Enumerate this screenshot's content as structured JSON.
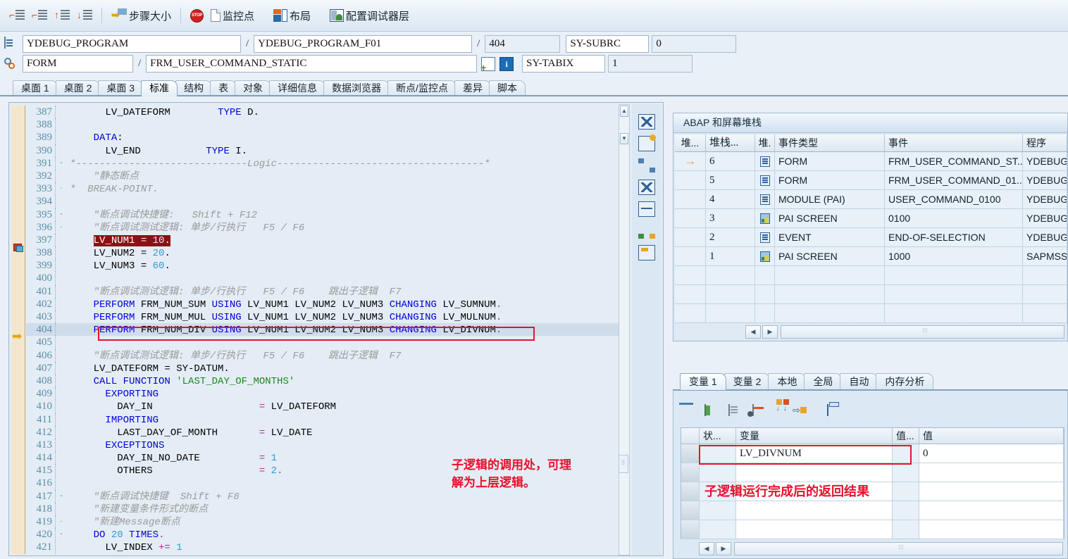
{
  "toolbar": {
    "step_icons": [
      "step-into-icon",
      "step-over-icon",
      "step-return-icon",
      "run-to-cursor-icon"
    ],
    "step_size_label": "步骤大小",
    "stop_label": "STOP",
    "watchpoint_label": "监控点",
    "layout_label": "布局",
    "config_layer_label": "配置调试器层"
  },
  "fields": {
    "program_main": "YDEBUG_PROGRAM",
    "program_include": "YDEBUG_PROGRAM_F01",
    "line_number": "404",
    "sy_subrc_label": "SY-SUBRC",
    "sy_subrc_value": "0",
    "event_type": "FORM",
    "event_name": "FRM_USER_COMMAND_STATIC",
    "sy_tabix_label": "SY-TABIX",
    "sy_tabix_value": "1",
    "separator": "/"
  },
  "tabs": [
    {
      "label": "桌面 1",
      "active": false
    },
    {
      "label": "桌面 2",
      "active": false
    },
    {
      "label": "桌面 3",
      "active": false
    },
    {
      "label": "标准",
      "active": true
    },
    {
      "label": "结构",
      "active": false
    },
    {
      "label": "表",
      "active": false
    },
    {
      "label": "对象",
      "active": false
    },
    {
      "label": "详细信息",
      "active": false
    },
    {
      "label": "数据浏览器",
      "active": false
    },
    {
      "label": "断点/监控点",
      "active": false
    },
    {
      "label": "差异",
      "active": false
    },
    {
      "label": "脚本",
      "active": false
    }
  ],
  "code": {
    "lines": [
      {
        "n": "387",
        "fold": "",
        "mark": "",
        "html": "      <span class=\"k\">LV_DATEFORM</span>        <span class=\"kw\">TYPE</span> D."
      },
      {
        "n": "388",
        "fold": "",
        "mark": "",
        "html": ""
      },
      {
        "n": "389",
        "fold": "",
        "mark": "",
        "html": "    <span class=\"kw\">DATA</span>:"
      },
      {
        "n": "390",
        "fold": "",
        "mark": "",
        "html": "      LV_END           <span class=\"kw\">TYPE</span> I."
      },
      {
        "n": "391",
        "fold": "-",
        "mark": "",
        "html": "<span class=\"cm\">*-----------------------------Logic-----------------------------------*</span>"
      },
      {
        "n": "392",
        "fold": "",
        "mark": "",
        "html": "    <span class=\"cm\">\"静态断点</span>"
      },
      {
        "n": "393",
        "fold": "·",
        "mark": "",
        "html": "<span class=\"cm\">*  BREAK-POINT.</span>"
      },
      {
        "n": "394",
        "fold": "",
        "mark": "",
        "html": ""
      },
      {
        "n": "395",
        "fold": "-",
        "mark": "",
        "html": "    <span class=\"cm\">\"断点调试快捷键:   Shift + F12</span>"
      },
      {
        "n": "396",
        "fold": "·",
        "mark": "",
        "html": "    <span class=\"cm\">\"断点调试测试逻辑: 单步/行执行   F5 / F6</span>"
      },
      {
        "n": "397",
        "fold": "",
        "mark": "bp",
        "html": "HILITE"
      },
      {
        "n": "398",
        "fold": "",
        "mark": "",
        "html": "    LV_NUM2 = <span class=\"num\">20</span>."
      },
      {
        "n": "399",
        "fold": "",
        "mark": "",
        "html": "    LV_NUM3 = <span class=\"num\">60</span>."
      },
      {
        "n": "400",
        "fold": "",
        "mark": "",
        "html": ""
      },
      {
        "n": "401",
        "fold": "",
        "mark": "",
        "html": "    <span class=\"cm\">\"断点调试测试逻辑: 单步/行执行   F5 / F6    跳出子逻辑  F7</span>"
      },
      {
        "n": "402",
        "fold": "",
        "mark": "",
        "html": "    <span class=\"kw\">PERFORM</span> FRM_NUM_SUM <span class=\"kw\">USING</span> LV_NUM1 LV_NUM2 LV_NUM3 <span class=\"kw\">CHANGING</span> LV_SUMNUM<span class=\"op\">.</span>"
      },
      {
        "n": "403",
        "fold": "",
        "mark": "",
        "html": "    <span class=\"kw\">PERFORM</span> FRM_NUM_MUL <span class=\"kw\">USING</span> LV_NUM1 LV_NUM2 LV_NUM3 <span class=\"kw\">CHANGING</span> LV_MULNUM<span class=\"op\">.</span>"
      },
      {
        "n": "404",
        "fold": "",
        "mark": "cur",
        "html": "    <span class=\"kw\">PERFORM</span> FRM_NUM_DIV <span class=\"kw\">USING</span> LV_NUM1 LV_NUM2 LV_NUM3 <span class=\"kw\">CHANGING</span> LV_DIVNUM<span class=\"op\">.</span>"
      },
      {
        "n": "405",
        "fold": "",
        "mark": "",
        "html": ""
      },
      {
        "n": "406",
        "fold": "",
        "mark": "",
        "html": "    <span class=\"cm\">\"断点调试测试逻辑: 单步/行执行   F5 / F6    跳出子逻辑  F7</span>"
      },
      {
        "n": "407",
        "fold": "",
        "mark": "",
        "html": "    LV_DATEFORM = SY-DATUM."
      },
      {
        "n": "408",
        "fold": "",
        "mark": "",
        "html": "    <span class=\"kw\">CALL FUNCTION</span> <span class=\"str\">'LAST_DAY_OF_MONTHS'</span>"
      },
      {
        "n": "409",
        "fold": "",
        "mark": "",
        "html": "      <span class=\"kw\">EXPORTING</span>"
      },
      {
        "n": "410",
        "fold": "",
        "mark": "",
        "html": "        DAY_IN                  <span class=\"op\">=</span> LV_DATEFORM"
      },
      {
        "n": "411",
        "fold": "",
        "mark": "",
        "html": "      <span class=\"kw\">IMPORTING</span>"
      },
      {
        "n": "412",
        "fold": "",
        "mark": "",
        "html": "        LAST_DAY_OF_MONTH       <span class=\"op\">=</span> LV_DATE"
      },
      {
        "n": "413",
        "fold": "",
        "mark": "",
        "html": "      <span class=\"kw\">EXCEPTIONS</span>"
      },
      {
        "n": "414",
        "fold": "",
        "mark": "",
        "html": "        DAY_IN_NO_DATE          <span class=\"op\">=</span> <span class=\"num\">1</span>"
      },
      {
        "n": "415",
        "fold": "",
        "mark": "",
        "html": "        OTHERS                  <span class=\"op\">=</span> <span class=\"num\">2</span><span class=\"op\">.</span>"
      },
      {
        "n": "416",
        "fold": "",
        "mark": "",
        "html": ""
      },
      {
        "n": "417",
        "fold": "-",
        "mark": "",
        "html": "    <span class=\"cm\">\"断点调试快捷键  Shift + F8</span>"
      },
      {
        "n": "418",
        "fold": "",
        "mark": "",
        "html": "    <span class=\"cm\">\"新建变量条件形式的断点</span>"
      },
      {
        "n": "419",
        "fold": "·",
        "mark": "",
        "html": "    <span class=\"cm\">\"新建Message断点</span>"
      },
      {
        "n": "420",
        "fold": "-",
        "mark": "",
        "html": "    <span class=\"kw\">DO</span> <span class=\"num\">20</span> <span class=\"kw\">TIMES</span><span class=\"op\">.</span>"
      },
      {
        "n": "421",
        "fold": "",
        "mark": "",
        "html": "      LV_INDEX <span class=\"op\">+=</span> <span class=\"num\">1</span>"
      }
    ],
    "highlight_line_397_text": "LV_NUM1 = 10.",
    "highlight_line_397_value": "10",
    "annotation_1": "子逻辑的调用处，可理\n解为上层逻辑。"
  },
  "stack_panel": {
    "title": "ABAP 和屏幕堆栈",
    "columns": [
      "堆...",
      "堆栈...",
      "堆.",
      "事件类型",
      "事件",
      "程序"
    ],
    "rows": [
      {
        "marker": "→",
        "stack": "6",
        "icon": "form-icon",
        "event_type": "FORM",
        "event": "FRM_USER_COMMAND_ST...",
        "program": "YDEBUG_"
      },
      {
        "marker": "",
        "stack": "5",
        "icon": "form-icon",
        "event_type": "FORM",
        "event": "FRM_USER_COMMAND_01...",
        "program": "YDEBUG_"
      },
      {
        "marker": "",
        "stack": "4",
        "icon": "form-icon",
        "event_type": "MODULE (PAI)",
        "event": "USER_COMMAND_0100",
        "program": "YDEBUG_"
      },
      {
        "marker": "",
        "stack": "3",
        "icon": "screen-icon",
        "event_type": "PAI SCREEN",
        "event": "0100",
        "program": "YDEBUG_"
      },
      {
        "marker": "",
        "stack": "2",
        "icon": "form-icon",
        "event_type": "EVENT",
        "event": "END-OF-SELECTION",
        "program": "YDEBUG_"
      },
      {
        "marker": "",
        "stack": "1",
        "icon": "screen-icon",
        "event_type": "PAI SCREEN",
        "event": "1000",
        "program": "SAPMSSY"
      }
    ],
    "empty_rows": 3
  },
  "variables_panel": {
    "tabs": [
      {
        "label": "变量 1",
        "active": true
      },
      {
        "label": "变量 2",
        "active": false
      },
      {
        "label": "本地",
        "active": false
      },
      {
        "label": "全局",
        "active": false
      },
      {
        "label": "自动",
        "active": false
      },
      {
        "label": "内存分析",
        "active": false
      }
    ],
    "toolbar_icons": [
      "delete-icon",
      "insert-row-icon",
      "copy-row-icon",
      "delete-row-icon",
      "compare-icon",
      "transfer-icon",
      "restore-icon"
    ],
    "columns": [
      "",
      "状...",
      "变量",
      "值...",
      "值"
    ],
    "rows": [
      {
        "status": "",
        "variable": "LV_DIVNUM",
        "value_type": "",
        "value": "0",
        "boxed": true
      },
      {
        "status": "",
        "variable": "",
        "value_type": "",
        "value": "",
        "boxed": false
      },
      {
        "status": "",
        "variable": "",
        "value_type": "",
        "value": "",
        "boxed": false
      },
      {
        "status": "",
        "variable": "",
        "value_type": "",
        "value": "",
        "boxed": false
      },
      {
        "status": "",
        "variable": "",
        "value_type": "",
        "value": "",
        "boxed": false
      }
    ],
    "annotation": "子逻辑运行完成后的返回结果"
  },
  "colors": {
    "annotation_red": "#e8112d",
    "breakpoint_highlight": "#8e0f14",
    "current_line": "#cfdcec",
    "panel_bg": "#dbe8f4",
    "code_bg": "#e4edf5",
    "keyword_blue": "#0000d8",
    "comment_grey": "#9a9a9a",
    "string_green": "#1a8a1a",
    "marker_orange": "#ef9b20"
  }
}
